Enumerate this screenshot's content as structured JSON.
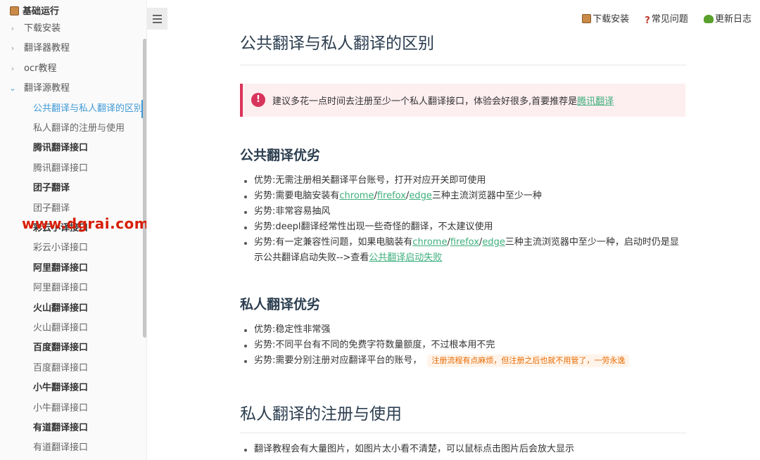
{
  "sidebar": {
    "root_label": "基础运行",
    "items": [
      {
        "label": "下载安装",
        "kind": "section",
        "chevron": "›"
      },
      {
        "label": "翻译器教程",
        "kind": "section",
        "chevron": "›"
      },
      {
        "label": "ocr教程",
        "kind": "section",
        "chevron": "›"
      },
      {
        "label": "翻译源教程",
        "kind": "section-open",
        "chevron": "⌄"
      },
      {
        "label": "公共翻译与私人翻译的区别",
        "kind": "active"
      },
      {
        "label": "私人翻译的注册与使用",
        "kind": "sub"
      },
      {
        "label": "腾讯翻译接口",
        "kind": "bold"
      },
      {
        "label": "腾讯翻译接口",
        "kind": "sub"
      },
      {
        "label": "团子翻译",
        "kind": "bold"
      },
      {
        "label": "团子翻译",
        "kind": "sub"
      },
      {
        "label": "彩云小译接口",
        "kind": "bold"
      },
      {
        "label": "彩云小译接口",
        "kind": "sub"
      },
      {
        "label": "阿里翻译接口",
        "kind": "bold"
      },
      {
        "label": "阿里翻译接口",
        "kind": "sub"
      },
      {
        "label": "火山翻译接口",
        "kind": "bold"
      },
      {
        "label": "火山翻译接口",
        "kind": "sub"
      },
      {
        "label": "百度翻译接口",
        "kind": "bold"
      },
      {
        "label": "百度翻译接口",
        "kind": "sub"
      },
      {
        "label": "小牛翻译接口",
        "kind": "bold"
      },
      {
        "label": "小牛翻译接口",
        "kind": "sub"
      },
      {
        "label": "有道翻译接口",
        "kind": "bold"
      },
      {
        "label": "有道翻译接口",
        "kind": "sub"
      }
    ],
    "watermark": "www.dgrai.com"
  },
  "topnav": {
    "download": "下载安装",
    "faq": "常见问题",
    "changelog": "更新日志"
  },
  "content": {
    "title": "公共翻译与私人翻译的区别",
    "alert": {
      "text": "建议多花一点时间去注册至少一个私人翻译接口，体验会好很多,首要推荐是",
      "link": "腾讯翻译"
    },
    "section1": {
      "heading": "公共翻译优劣",
      "b1": "优势:无需注册相关翻译平台账号，打开对应开关即可使用",
      "b2_pre": "劣势:需要电脑安装有",
      "chrome": "chrome",
      "firefox": "firefox",
      "edge": "edge",
      "sep": "/",
      "b2_post": "三种主流浏览器中至少一种",
      "b3": "劣势:非常容易抽风",
      "b4": "劣势:deepl翻译经常性出现一些奇怪的翻译，不太建议使用",
      "b5_pre": "劣势:有一定兼容性问题，如果电脑装有",
      "b5_post": "三种主流浏览器中至少一种，启动时仍是显示公共翻译启动失败-->查看",
      "b5_link": "公共翻译启动失败"
    },
    "section2": {
      "heading": "私人翻译优劣",
      "b1": "优势:稳定性非常强",
      "b2": "劣势:不同平台有不同的免费字符数量额度，不过根本用不完",
      "b3": "劣势:需要分别注册对应翻译平台的账号，",
      "b3_code": "注册流程有点麻烦，但注册之后也就不用管了，一劳永逸"
    },
    "section3": {
      "heading": "私人翻译的注册与使用",
      "b1": "翻译教程会有大量图片，如图片太小看不清楚，可以鼠标点击图片后会放大显示"
    }
  }
}
